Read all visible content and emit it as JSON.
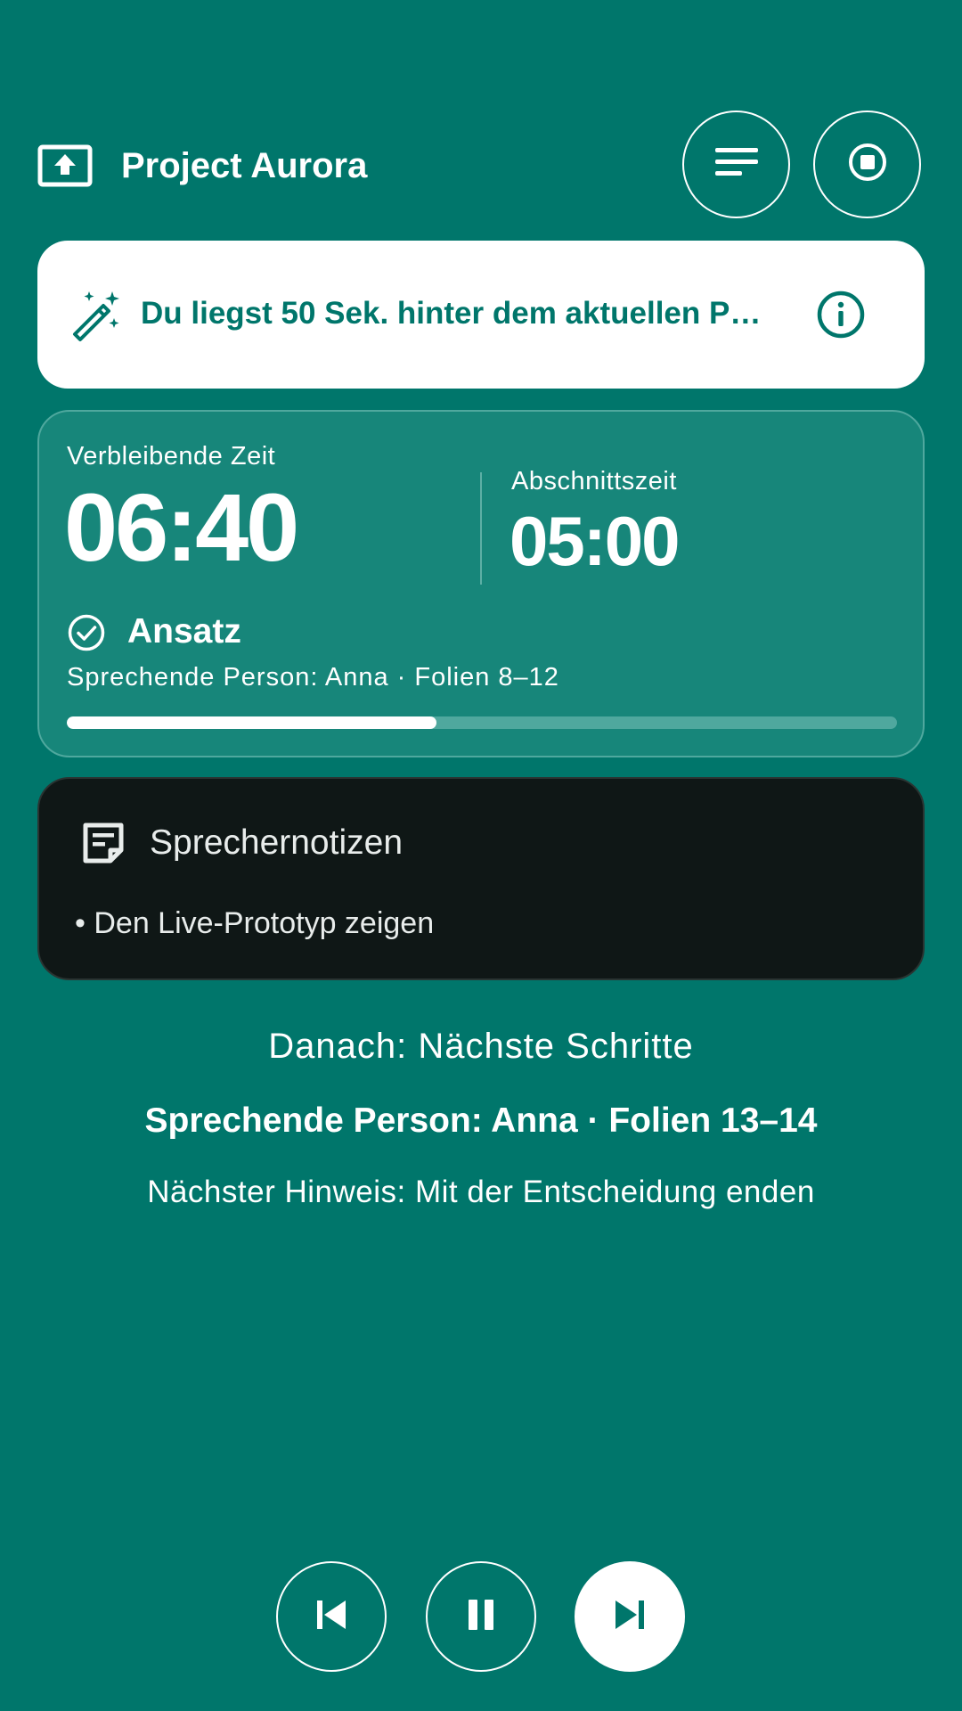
{
  "header": {
    "title": "Project Aurora",
    "icons": {
      "app": "presentation-upload-icon",
      "menu": "menu-lines-icon",
      "stop": "stop-icon"
    }
  },
  "pace_card": {
    "message": "Du liegst 50 Sek. hinter dem aktuellen P…",
    "icons": {
      "left": "magic-wand-icon",
      "right": "info-icon"
    }
  },
  "timer_card": {
    "remaining_label": "Verbleibende Zeit",
    "remaining_value": "06:40",
    "section_label": "Abschnittszeit",
    "section_value": "05:00",
    "segment_name": "Ansatz",
    "segment_meta": "Sprechende Person: Anna · Folien 8–12",
    "progress": 0.445,
    "icons": {
      "segment": "check-circle-icon"
    }
  },
  "notes": {
    "title": "Sprechernotizen",
    "items": [
      "• Den Live-Prototyp zeigen"
    ],
    "icon": "notes-icon"
  },
  "next": {
    "title": "Danach: Nächste Schritte",
    "speaker": "Sprechende Person: Anna · Folien 13–14",
    "hint": "Nächster Hinweis: Mit der Entscheidung enden"
  },
  "controls": {
    "icons": [
      "skip-previous-icon",
      "pause-icon",
      "skip-next-icon"
    ]
  },
  "colors": {
    "background": "#00766B",
    "card": "#17867A",
    "notes_background": "#0F1716",
    "accent": "#ffffff"
  }
}
